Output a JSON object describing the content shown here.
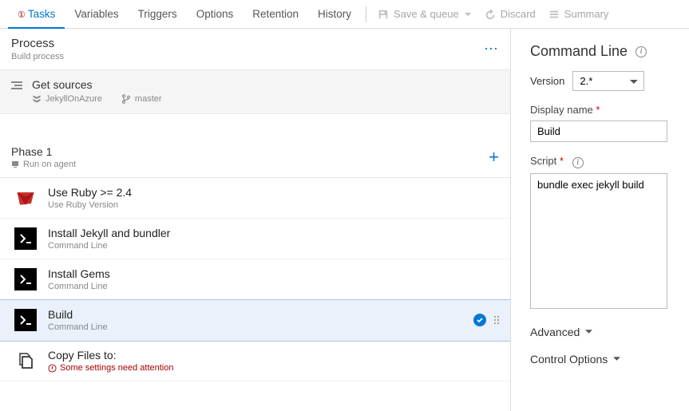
{
  "tabs": {
    "tasks": "Tasks",
    "variables": "Variables",
    "triggers": "Triggers",
    "options": "Options",
    "retention": "Retention",
    "history": "History"
  },
  "toolbar": {
    "save_queue": "Save & queue",
    "discard": "Discard",
    "summary": "Summary"
  },
  "process": {
    "title": "Process",
    "sub": "Build process"
  },
  "sources": {
    "title": "Get sources",
    "repo": "JekyllOnAzure",
    "branch": "master"
  },
  "phase": {
    "title": "Phase 1",
    "sub": "Run on agent"
  },
  "steps": [
    {
      "title": "Use Ruby >= 2.4",
      "sub": "Use Ruby Version",
      "icon": "ruby"
    },
    {
      "title": "Install Jekyll and bundler",
      "sub": "Command Line",
      "icon": "cmd"
    },
    {
      "title": "Install Gems",
      "sub": "Command Line",
      "icon": "cmd"
    },
    {
      "title": "Build",
      "sub": "Command Line",
      "icon": "cmd",
      "selected": true
    },
    {
      "title": "Copy Files to:",
      "sub": "Some settings need attention",
      "icon": "copy",
      "warn": true
    }
  ],
  "panel": {
    "heading": "Command Line",
    "version_label": "Version",
    "version_value": "2.*",
    "display_name_label": "Display name",
    "display_name_value": "Build",
    "script_label": "Script",
    "script_value": "bundle exec jekyll build",
    "advanced": "Advanced",
    "control_options": "Control Options"
  }
}
